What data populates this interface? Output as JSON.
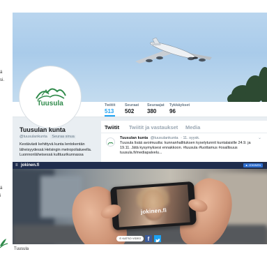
{
  "left_fragments": [
    "ä",
    "si.",
    "ä",
    "i"
  ],
  "twitter": {
    "avatar_logo_text": "Tuusula",
    "stats": [
      {
        "label": "Twiitit",
        "value": "513"
      },
      {
        "label": "Seuraat",
        "value": "502"
      },
      {
        "label": "Seuraajat",
        "value": "380"
      },
      {
        "label": "Tykkäykset",
        "value": "96"
      }
    ],
    "profile": {
      "name": "Tuusulan kunta",
      "handle": "@tuusulankunta",
      "follows_you": "Seuraa sinua",
      "bio": "Kestävästi kehittyvä kunta lentokentän läheisyydessä Helsingin metropolialueella. Luonnonläheisessä kulttuurikunnassa"
    },
    "tabs": [
      "Twiitit",
      "Twiitit ja vastaukset",
      "Media"
    ],
    "tweet": {
      "name": "Tuusulan kunta",
      "handle": "@tuusulankunta",
      "date": "· 11. syysk.",
      "chevron": "⌄",
      "text": "Tuusula lisää avoimuutta: kunnanhallituksen kyselytunnit kuntalaisille 24.9. ja 19.11. Jätä kysymyksesi ennakkoon. #tuusula #luottamus #osallisuus tuusula.fi/mediapalvelu..."
    }
  },
  "jokinen": {
    "menu_glyph": "≡",
    "site": "jokinen.fi",
    "nav_button": "▲ JOKINEN",
    "phone_text": "jokinen.fi",
    "cta": "⊙ KATSO VIDEO",
    "facebook": "f"
  },
  "caption": "Tuusula",
  "icons": {
    "menu": "menu-icon",
    "facebook": "facebook-icon",
    "twitter": "twitter-bird-icon",
    "airplane": "airplane-icon",
    "logo": "tuusula-logo-icon"
  },
  "colors": {
    "twitter_blue": "#1da1f2",
    "navy": "#1f2d4d",
    "tuusula_green": "#2f8a4a",
    "facebook_blue": "#3b5998"
  }
}
